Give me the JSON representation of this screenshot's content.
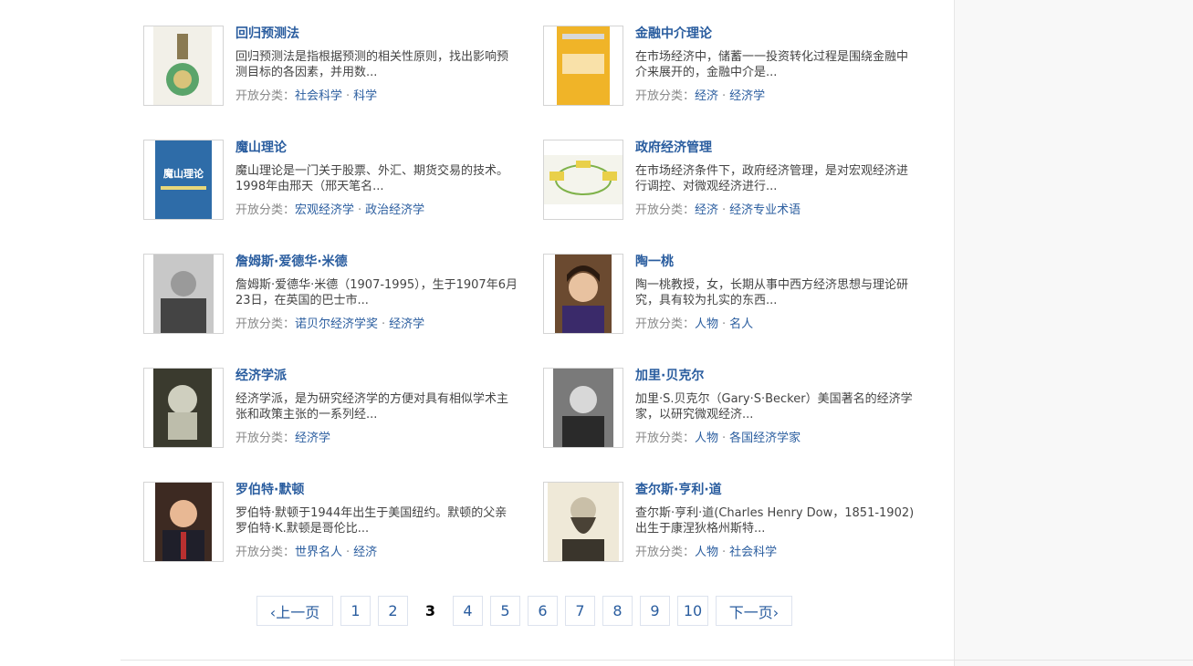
{
  "category_label": "开放分类：",
  "entries": [
    {
      "title": "回归预测法",
      "desc": "回归预测法是指根据预测的相关性原则，找出影响预测目标的各因素，并用数...",
      "cats": [
        "社会科学",
        "科学"
      ],
      "thumb_icon": "book-cover-icon"
    },
    {
      "title": "金融中介理论",
      "desc": "在市场经济中，储蓄一一投资转化过程是围绕金融中介来展开的，金融中介是...",
      "cats": [
        "经济",
        "经济学"
      ],
      "thumb_icon": "book-cover-icon"
    },
    {
      "title": "魔山理论",
      "desc": "魔山理论是一门关于股票、外汇、期货交易的技术。1998年由邢天（邢天笔名...",
      "cats": [
        "宏观经济学",
        "政治经济学"
      ],
      "thumb_icon": "book-cover-icon",
      "thumb_text": "魔山理论"
    },
    {
      "title": "政府经济管理",
      "desc": "在市场经济条件下，政府经济管理，是对宏观经济进行调控、对微观经济进行...",
      "cats": [
        "经济",
        "经济专业术语"
      ],
      "thumb_icon": "diagram-icon"
    },
    {
      "title": "詹姆斯·爱德华·米德",
      "desc": "詹姆斯·爱德华·米德（1907-1995），生于1907年6月23日，在英国的巴士市...",
      "cats": [
        "诺贝尔经济学奖",
        "经济学"
      ],
      "thumb_icon": "portrait-icon"
    },
    {
      "title": "陶一桃",
      "desc": "陶一桃教授，女，长期从事中西方经济思想与理论研究，具有较为扎实的东西...",
      "cats": [
        "人物",
        "名人"
      ],
      "thumb_icon": "portrait-icon"
    },
    {
      "title": "经济学派",
      "desc": "经济学派，是为研究经济学的方便对具有相似学术主张和政策主张的一系列经...",
      "cats": [
        "经济学"
      ],
      "thumb_icon": "statue-icon"
    },
    {
      "title": "加里·贝克尔",
      "desc": "加里·S.贝克尔（Gary·S·Becker）美国著名的经济学家，以研究微观经济...",
      "cats": [
        "人物",
        "各国经济学家"
      ],
      "thumb_icon": "portrait-icon"
    },
    {
      "title": "罗伯特·默顿",
      "desc": "罗伯特·默顿于1944年出生于美国纽约。默顿的父亲罗伯特·K.默顿是哥伦比...",
      "cats": [
        "世界名人",
        "经济"
      ],
      "thumb_icon": "portrait-icon"
    },
    {
      "title": "查尔斯·亨利·道",
      "desc": "查尔斯·亨利·道(Charles Henry Dow，1851-1902) 出生于康涅狄格州斯特...",
      "cats": [
        "人物",
        "社会科学"
      ],
      "thumb_icon": "portrait-icon"
    }
  ],
  "pager": {
    "prev": "上一页",
    "next": "下一页",
    "pages": [
      "1",
      "2",
      "3",
      "4",
      "5",
      "6",
      "7",
      "8",
      "9",
      "10"
    ],
    "current": "3"
  }
}
